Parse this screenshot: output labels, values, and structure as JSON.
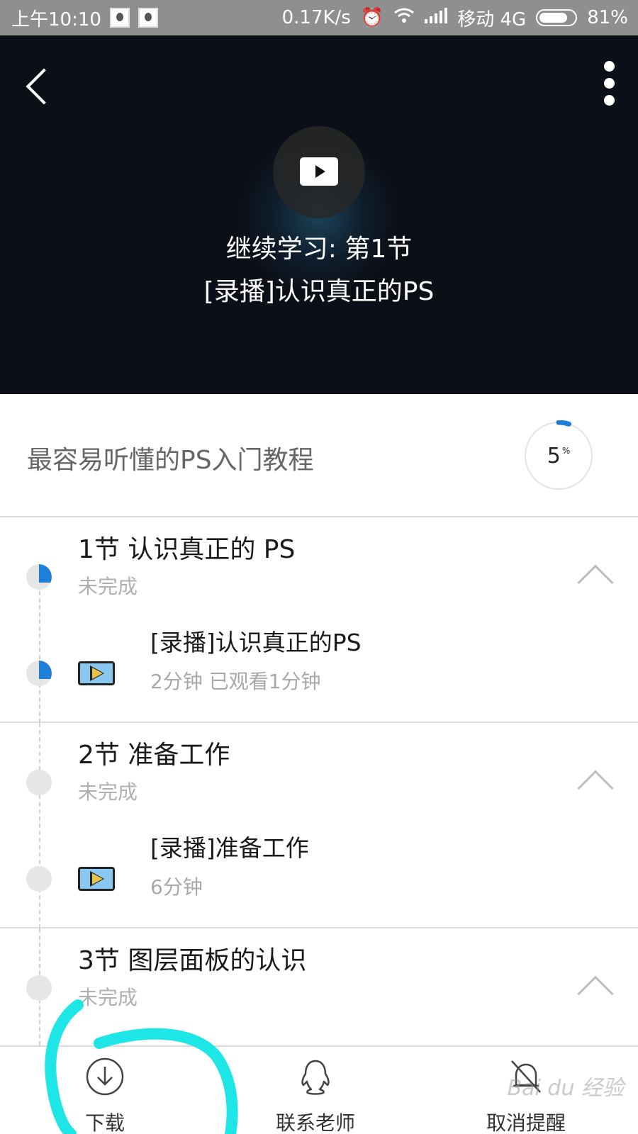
{
  "status_bar": {
    "time": "上午10:10",
    "net_speed": "0.17K/s",
    "carrier": "移动 4G",
    "battery": "81%",
    "battery_level": 0.81
  },
  "video": {
    "line1": "继续学习: 第1节",
    "line2": "[录播]认识真正的PS"
  },
  "course": {
    "title": "最容易听懂的PS入门教程",
    "progress_value": "5",
    "progress_unit": "%",
    "progress_fraction": 0.05
  },
  "sections": [
    {
      "title": "1节  认识真正的 PS",
      "status": "未完成",
      "lesson_title": "[录播]认识真正的PS",
      "lesson_meta": "2分钟 已观看1分钟"
    },
    {
      "title": "2节  准备工作",
      "status": "未完成",
      "lesson_title": "[录播]准备工作",
      "lesson_meta": "6分钟"
    },
    {
      "title": "3节  图层面板的认识",
      "status": "未完成"
    }
  ],
  "bottom_bar": {
    "download": "下载",
    "contact_teacher": "联系老师",
    "cancel_reminder": "取消提醒"
  },
  "watermark": "Bai du 经验",
  "colors": {
    "accent": "#1f7fd8",
    "annotation": "#1ee6e6"
  }
}
